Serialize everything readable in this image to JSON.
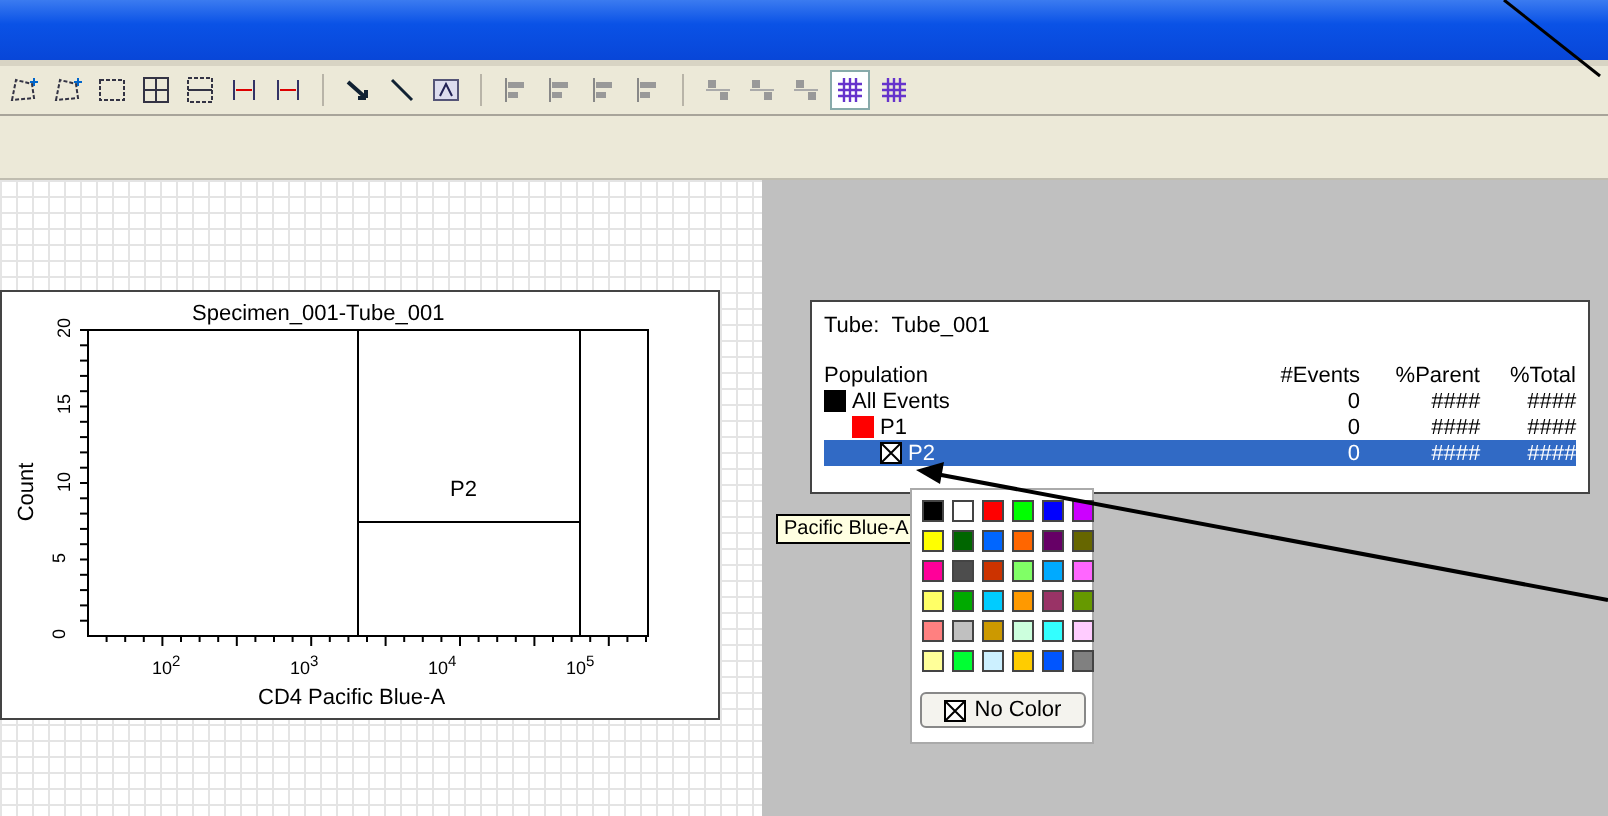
{
  "toolbar": [
    {
      "kind": "gate"
    },
    {
      "kind": "gate"
    },
    {
      "kind": "rect"
    },
    {
      "kind": "quad"
    },
    {
      "kind": "split"
    },
    {
      "kind": "interval"
    },
    {
      "kind": "interval"
    },
    {
      "kind": "sep"
    },
    {
      "kind": "arrow"
    },
    {
      "kind": "line"
    },
    {
      "kind": "text"
    },
    {
      "kind": "sep"
    },
    {
      "kind": "align"
    },
    {
      "kind": "align"
    },
    {
      "kind": "align"
    },
    {
      "kind": "align"
    },
    {
      "kind": "sep"
    },
    {
      "kind": "dist"
    },
    {
      "kind": "dist"
    },
    {
      "kind": "dist"
    },
    {
      "kind": "grid",
      "selected": true
    },
    {
      "kind": "grid",
      "selected": false
    }
  ],
  "plot": {
    "title": "Specimen_001-Tube_001",
    "ylabel": "Count",
    "xlabel": "CD4 Pacific Blue-A",
    "yticks": [
      "0",
      "5",
      "10",
      "15",
      "20"
    ],
    "xticks": [
      "10$^{2}$",
      "10$^{3}$",
      "10$^{4}$",
      "10$^{5}$"
    ],
    "gate_label": "P2"
  },
  "hierarchy": {
    "tube_label": "Tube:",
    "tube": "Tube_001",
    "columns": [
      "Population",
      "#Events",
      "%Parent",
      "%Total"
    ],
    "rows": [
      {
        "name": "All Events",
        "kind": "color",
        "color": "#000000",
        "events": "0",
        "parent": "####",
        "total": "####",
        "selected": false,
        "children": [
          {
            "name": "P1",
            "kind": "color",
            "color": "#ff0000",
            "events": "0",
            "parent": "####",
            "total": "####",
            "selected": false,
            "children": [
              {
                "name": "P2",
                "kind": "no-color",
                "events": "0",
                "parent": "####",
                "total": "####",
                "selected": true
              }
            ]
          }
        ]
      }
    ]
  },
  "tooltip": "Pacific Blue-A",
  "palette": {
    "colors": [
      {
        "color": "#000000"
      },
      {
        "color": "#ffffff"
      },
      {
        "color": "#ff0000"
      },
      {
        "color": "#00ff00"
      },
      {
        "color": "#0000ff"
      },
      {
        "color": "#cc00ff"
      },
      {
        "color": "#ffff00"
      },
      {
        "color": "#006600"
      },
      {
        "color": "#0066ff"
      },
      {
        "color": "#ff6600"
      },
      {
        "color": "#660066"
      },
      {
        "color": "#666600"
      },
      {
        "color": "#ff0099"
      },
      {
        "color": "#4d4d4d"
      },
      {
        "color": "#cc3300"
      },
      {
        "color": "#80ff66"
      },
      {
        "color": "#00aaff"
      },
      {
        "color": "#ff66ff"
      },
      {
        "color": "#ffff66"
      },
      {
        "color": "#00aa00"
      },
      {
        "color": "#00ccff"
      },
      {
        "color": "#ff9900"
      },
      {
        "color": "#993366"
      },
      {
        "color": "#669900"
      },
      {
        "color": "#ff8080"
      },
      {
        "color": "#c0c0c0"
      },
      {
        "color": "#cc9900"
      },
      {
        "color": "#ccffdd"
      },
      {
        "color": "#33ffff"
      },
      {
        "color": "#ffccff"
      },
      {
        "color": "#ffff99"
      },
      {
        "color": "#00ff33"
      },
      {
        "color": "#ccf0ff"
      },
      {
        "color": "#ffcc00"
      },
      {
        "color": "#0055ff"
      },
      {
        "color": "#808080"
      }
    ],
    "no_color": "No Color"
  }
}
